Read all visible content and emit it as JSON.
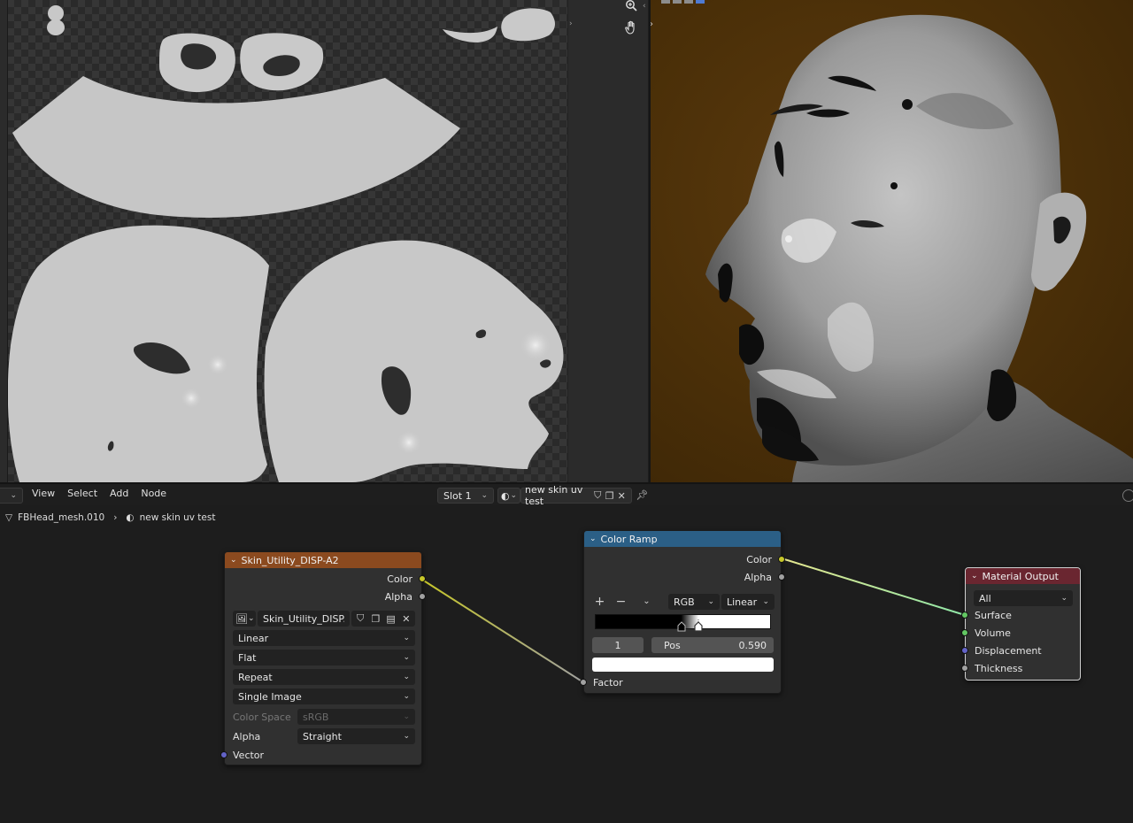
{
  "node_header": {
    "menus": [
      "View",
      "Select",
      "Add",
      "Node"
    ],
    "slot": "Slot 1",
    "material": "new skin uv test"
  },
  "breadcrumb": {
    "object": "FBHead_mesh.010",
    "material": "new skin uv test"
  },
  "image_node": {
    "title": "Skin_Utility_DISP-A2",
    "outputs": [
      "Color",
      "Alpha"
    ],
    "image_name": "Skin_Utility_DISP...",
    "interpolation": "Linear",
    "projection": "Flat",
    "extension": "Repeat",
    "source": "Single Image",
    "color_space_label": "Color Space",
    "color_space": "sRGB",
    "alpha_label": "Alpha",
    "alpha_mode": "Straight",
    "input": "Vector",
    "header_color": "#8b4a1f"
  },
  "color_ramp_node": {
    "title": "Color Ramp",
    "outputs": [
      "Color",
      "Alpha"
    ],
    "color_mode": "RGB",
    "interpolation": "Linear",
    "stop_index": "1",
    "pos_label": "Pos",
    "pos_value": "0.590",
    "input": "Factor",
    "header_color": "#2b5f86"
  },
  "material_output_node": {
    "title": "Material Output",
    "target": "All",
    "inputs": [
      "Surface",
      "Volume",
      "Displacement",
      "Thickness"
    ],
    "header_color": "#6a2630"
  },
  "icons": {
    "zoom": "zoom-icon",
    "hand": "hand-pan-icon",
    "pin": "pin-icon"
  },
  "colors": {
    "viewport_bg": "#4a2f08",
    "uv_island": "#c8c8c8"
  }
}
